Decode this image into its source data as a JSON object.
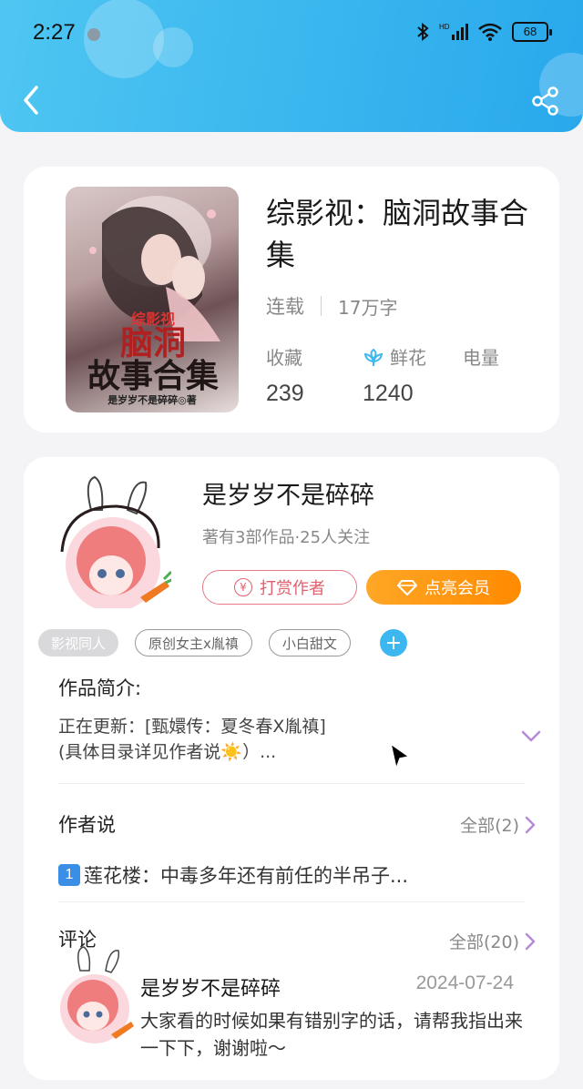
{
  "status_bar": {
    "time": "2:27",
    "battery": "68",
    "network": "HD"
  },
  "book": {
    "title": "综影视：脑洞故事合集",
    "status": "连载",
    "word_count": "17万字",
    "cover": {
      "subtitle": "综影视",
      "title_line1": "脑洞",
      "title_line2": "故事合集",
      "author_line": "是岁岁不是碎碎◎著"
    },
    "stats": [
      {
        "label": "收藏",
        "value": "239"
      },
      {
        "label": "鲜花",
        "value": "1240"
      },
      {
        "label": "电量",
        "value": ""
      }
    ]
  },
  "author": {
    "name": "是岁岁不是碎碎",
    "subtitle": "著有3部作品·25人关注",
    "reward_label": "打赏作者",
    "vip_label": "点亮会员"
  },
  "tags": [
    "影视同人",
    "原创女主x胤禛",
    "小白甜文"
  ],
  "intro": {
    "title": "作品简介:",
    "line1": "正在更新：[甄嬛传：夏冬春X胤禛]",
    "line2": "(具体目录详见作者说☀️）..."
  },
  "author_says": {
    "title": "作者说",
    "link": "全部(2)",
    "badge": "1",
    "text": "莲花楼：中毒多年还有前任的半吊子..."
  },
  "comments": {
    "title": "评论",
    "link": "全部(20)",
    "items": [
      {
        "user": "是岁岁不是碎碎",
        "date": "2024-07-24",
        "text": "大家看的时候如果有错别字的话，请帮我指出来一下下，谢谢啦～"
      }
    ]
  },
  "colors": {
    "header": "#39b6ee",
    "vip": "#ff8a00",
    "reward": "#e0606e",
    "accent_chevron": "#b48ad8"
  }
}
